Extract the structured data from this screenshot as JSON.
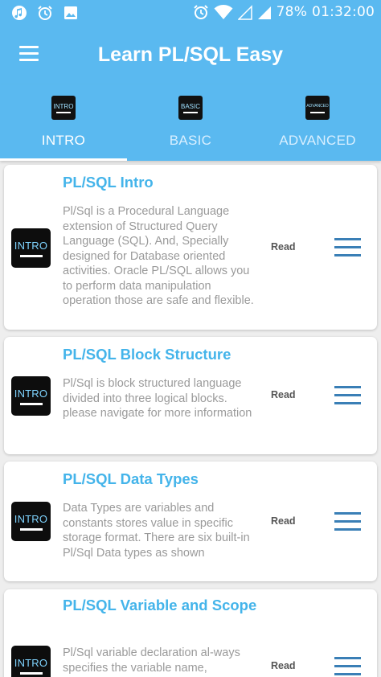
{
  "status": {
    "icons": [
      "music-note-icon",
      "alarm-icon",
      "image-icon",
      "alarm-clock-icon",
      "wifi-icon",
      "no-signal-icon",
      "signal-icon"
    ],
    "battery": "78%",
    "time": "01:32:00"
  },
  "toolbar": {
    "title": "Learn PL/SQL Easy",
    "menu_icon": "hamburger-menu-icon"
  },
  "colors": {
    "primary": "#5ab9f0",
    "title_text": "#44b4ea",
    "menu_icon": "#3a7fb6"
  },
  "tabs": [
    {
      "label": "INTRO",
      "icon_text": "INTRO",
      "active": true
    },
    {
      "label": "BASIC",
      "icon_text": "BASIC",
      "active": false
    },
    {
      "label": "ADVANCED",
      "icon_text": "ADVANCED",
      "active": false
    }
  ],
  "cards": [
    {
      "title": "PL/SQL Intro",
      "thumb_text": "INTRO",
      "description": "Pl/Sql is a Procedural Language extension of Structured Query Language (SQL). And, Specially designed for Database oriented activities. Oracle PL/SQL allows you to perform data manipulation operation those are safe and flexible.",
      "action": "Read"
    },
    {
      "title": "PL/SQL Block Structure",
      "thumb_text": "INTRO",
      "description": "Pl/Sql is block structured language divided into three logical blocks. please navigate for more information",
      "action": "Read"
    },
    {
      "title": "PL/SQL Data Types",
      "thumb_text": "INTRO",
      "description": "Data Types are variables and constants stores value in specific storage format. There are six built-in Pl/Sql Data types as shown",
      "action": "Read"
    },
    {
      "title": "PL/SQL Variable and Scope",
      "thumb_text": "INTRO",
      "description": "Pl/Sql variable declaration al-ways specifies the variable name,",
      "action": "Read"
    }
  ]
}
